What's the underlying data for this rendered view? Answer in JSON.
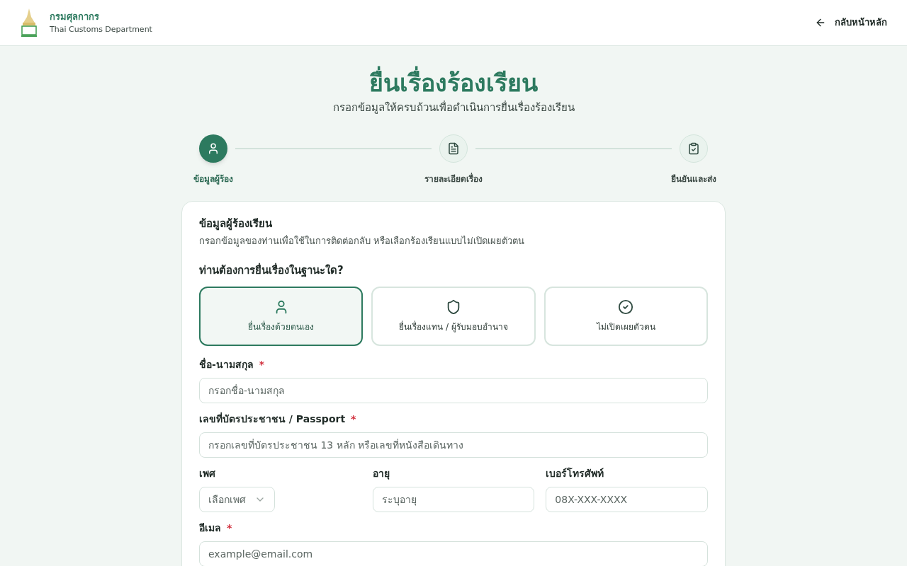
{
  "header": {
    "title": "กรมศุลกากร",
    "subtitle": "Thai Customs Department",
    "back_link": "กลับหน้าหลัก"
  },
  "page": {
    "title": "ยื่นเรื่องร้องเรียน",
    "subtitle": "กรอกข้อมูลให้ครบถ้วนเพื่อดำเนินการยื่นเรื่องร้องเรียน"
  },
  "steps": [
    {
      "label": "ข้อมูลผู้ร้อง",
      "selected": true
    },
    {
      "label": "รายละเอียดเรื่อง",
      "selected": false
    },
    {
      "label": "ยืนยันและส่ง",
      "selected": false
    }
  ],
  "card": {
    "title": "ข้อมูลผู้ร้องเรียน",
    "description": "กรอกข้อมูลของท่านเพื่อใช้ในการติดต่อกลับ หรือเลือกร้องเรียนแบบไม่เปิดเผยตัวตน",
    "question": "ท่านต้องการยื่นเรื่องในฐานะใด?",
    "options": [
      {
        "label": "ยื่นเรื่องด้วยตนเอง",
        "selected": true
      },
      {
        "label": "ยื่นเรื่องแทน / ผู้รับมอบอำนาจ",
        "selected": false
      },
      {
        "label": "ไม่เปิดเผยตัวตน",
        "selected": false
      }
    ],
    "rows": [
      [
        {
          "kind": "text",
          "label": "ชื่อ-นามสกุล",
          "required_mark": "*",
          "placeholder": "กรอกชื่อ-นามสกุล"
        }
      ],
      [
        {
          "kind": "text",
          "label": "เลขที่บัตรประชาชน / Passport",
          "required_mark": "*",
          "placeholder": "กรอกเลขที่บัตรประชาชน 13 หลัก หรือเลขที่หนังสือเดินทาง"
        }
      ],
      [
        {
          "kind": "select",
          "label": "เพศ",
          "placeholder": "เลือกเพศ"
        },
        {
          "kind": "text",
          "label": "อายุ",
          "placeholder": "ระบุอายุ"
        },
        {
          "kind": "text",
          "label": "เบอร์โทรศัพท์",
          "placeholder": "08X-XXX-XXXX"
        }
      ],
      [
        {
          "kind": "text",
          "label": "อีเมล",
          "required_mark": "*",
          "placeholder": "example@email.com"
        }
      ]
    ]
  }
}
